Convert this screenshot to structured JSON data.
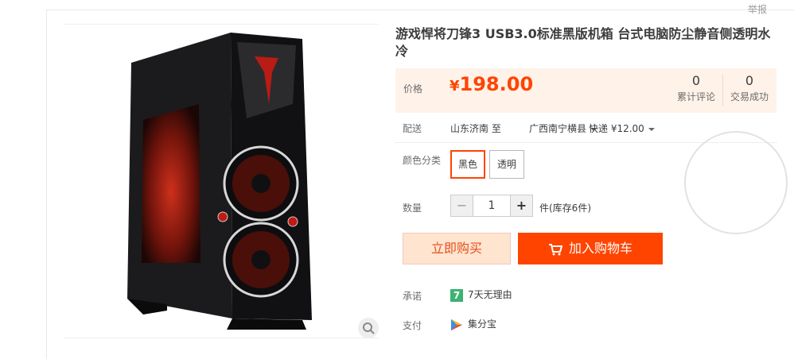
{
  "header": {
    "report_label": "举报"
  },
  "product": {
    "title": "游戏悍将刀锋3 USB3.0标准黑版机箱 台式电脑防尘静音侧透明水冷",
    "price_label": "价格",
    "currency": "¥",
    "price": "198.00",
    "reviews": {
      "count": "0",
      "label": "累计评论"
    },
    "sales": {
      "count": "0",
      "label": "交易成功"
    }
  },
  "delivery": {
    "label": "配送",
    "from": "山东济南 至",
    "to": "广西南宁横县",
    "shipping": "快递 ¥12.00"
  },
  "color": {
    "label": "颜色分类",
    "options": [
      "黑色",
      "透明"
    ],
    "selected": "黑色"
  },
  "quantity": {
    "label": "数量",
    "value": "1",
    "stock": "件(库存6件)"
  },
  "actions": {
    "buy_now": "立即购买",
    "add_to_cart": "加入购物车"
  },
  "promise": {
    "label": "承诺",
    "badge": "7",
    "text": "7天无理由"
  },
  "payment": {
    "label": "支付",
    "text": "集分宝"
  },
  "colors": {
    "accent": "#ff4400",
    "price_bg": "#fff2e8",
    "buy_bg": "#ffe4d0"
  }
}
